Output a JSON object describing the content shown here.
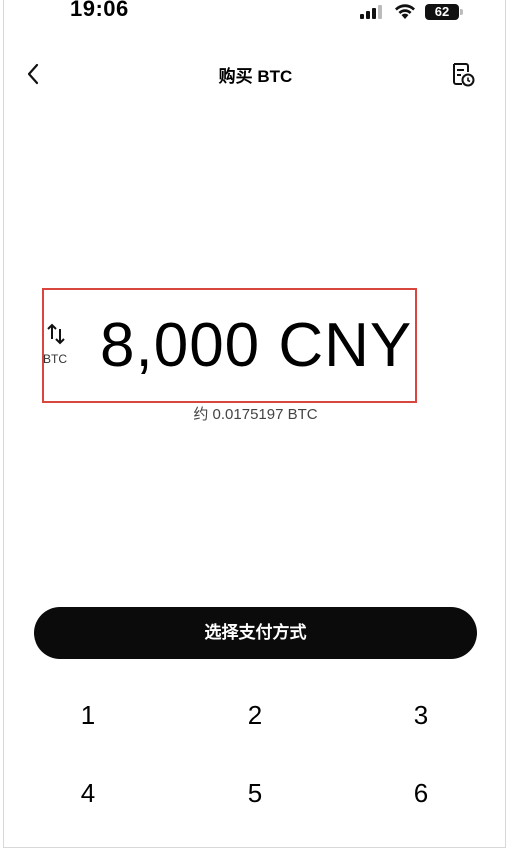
{
  "status_bar": {
    "time": "19:06",
    "battery": "62"
  },
  "header": {
    "title": "购买 BTC",
    "back_icon": "chevron-left-icon",
    "orders_icon": "order-history-icon"
  },
  "amount": {
    "value": "8,000 CNY",
    "swap_label": "BTC",
    "conversion": "约 0.0175197 BTC"
  },
  "cta": {
    "label": "选择支付方式"
  },
  "keypad": {
    "keys": [
      "1",
      "2",
      "3",
      "4",
      "5",
      "6"
    ]
  },
  "colors": {
    "highlight_border": "#d9463e",
    "button_bg": "#0b0b0b"
  }
}
